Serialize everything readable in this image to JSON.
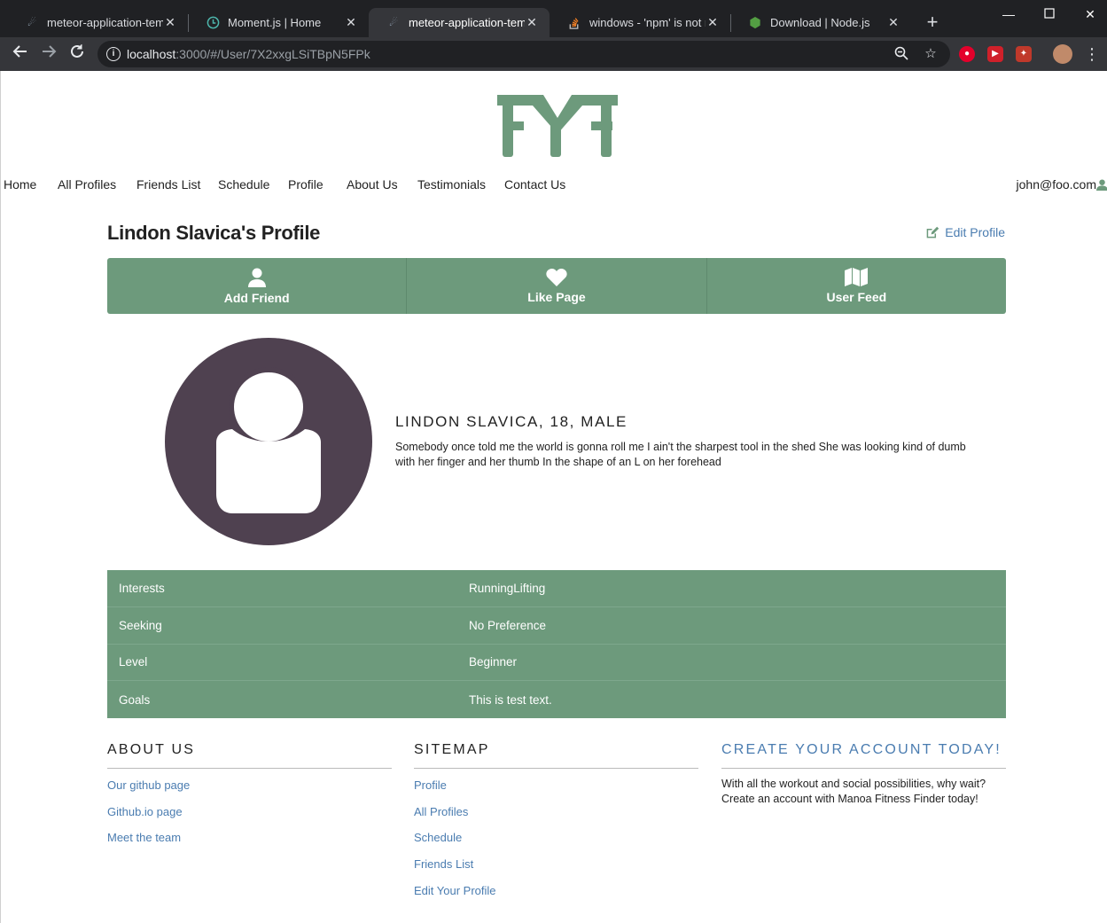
{
  "browser": {
    "tabs": [
      {
        "title": "meteor-application-template",
        "favicon": "meteor-icon",
        "active": false
      },
      {
        "title": "Moment.js | Home",
        "favicon": "clock-icon",
        "active": false
      },
      {
        "title": "meteor-application-template",
        "favicon": "meteor-icon",
        "active": true
      },
      {
        "title": "windows - 'npm' is not recognized",
        "favicon": "stackoverflow-icon",
        "active": false
      },
      {
        "title": "Download | Node.js",
        "favicon": "nodejs-icon",
        "active": false
      }
    ],
    "url_host": "localhost",
    "url_rest": ":3000/#/User/7X2xxgLSiTBpN5FPk"
  },
  "nav": {
    "items": [
      "Home",
      "All Profiles",
      "Friends List",
      "Schedule",
      "Profile",
      "About Us",
      "Testimonials",
      "Contact Us"
    ],
    "user": "john@foo.com"
  },
  "profile": {
    "title": "Lindon Slavica's Profile",
    "edit_label": "Edit Profile",
    "actions": [
      {
        "label": "Add Friend",
        "icon": "user-icon"
      },
      {
        "label": "Like Page",
        "icon": "heart-icon"
      },
      {
        "label": "User Feed",
        "icon": "map-icon"
      }
    ],
    "name_line": "LINDON SLAVICA, 18, MALE",
    "bio": "Somebody once told me the world is gonna roll me I ain't the sharpest tool in the shed She was looking kind of dumb with her finger and her thumb In the shape of an L on her forehead",
    "details": [
      {
        "key": "Interests",
        "value": "RunningLifting"
      },
      {
        "key": "Seeking",
        "value": "No Preference"
      },
      {
        "key": "Level",
        "value": "Beginner"
      },
      {
        "key": "Goals",
        "value": "This is test text."
      }
    ]
  },
  "footer": {
    "about": {
      "heading": "ABOUT US",
      "links": [
        "Our github page",
        "Github.io page",
        "Meet the team"
      ]
    },
    "sitemap": {
      "heading": "SITEMAP",
      "links": [
        "Profile",
        "All Profiles",
        "Schedule",
        "Friends List",
        "Edit Your Profile"
      ]
    },
    "cta": {
      "heading": "CREATE YOUR ACCOUNT TODAY!",
      "text": "With all the workout and social possibilities, why wait? Create an account with Manoa Fitness Finder today!"
    }
  },
  "colors": {
    "brand_green": "#6d9a7c",
    "avatar_bg": "#4f4150",
    "link_blue": "#4a7cb0"
  }
}
